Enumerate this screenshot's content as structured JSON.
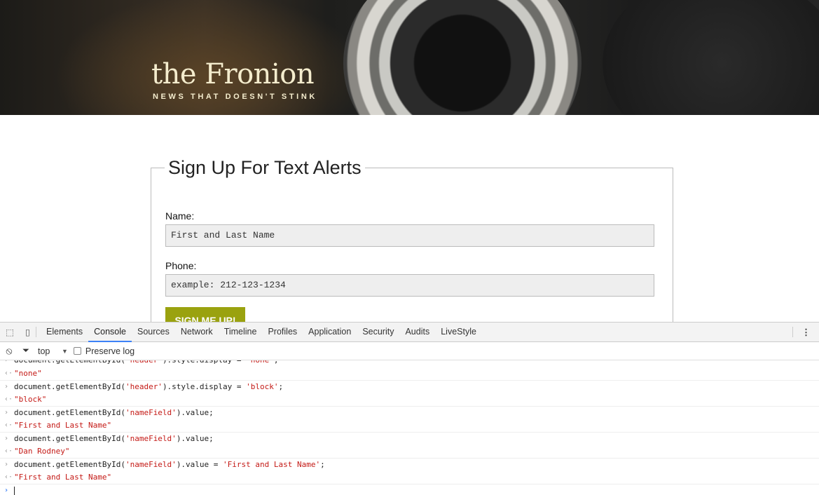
{
  "header": {
    "logo": "the Fronion",
    "tagline": "NEWS THAT DOESN'T STINK"
  },
  "form": {
    "legend": "Sign Up For Text Alerts",
    "name_label": "Name:",
    "name_value": "First and Last Name",
    "phone_label": "Phone:",
    "phone_value": "example: 212-123-1234",
    "submit_label": "SIGN ME UP!",
    "accent": "#9aa20f"
  },
  "devtools": {
    "tabs": [
      "Elements",
      "Console",
      "Sources",
      "Network",
      "Timeline",
      "Profiles",
      "Application",
      "Security",
      "Audits",
      "LiveStyle"
    ],
    "active_tab": "Console",
    "context": "top",
    "preserve_log": "Preserve log",
    "console": [
      {
        "type": "input",
        "pre": "document.getElementById(",
        "str": "'header'",
        "post": ").style.display = ",
        "str2": "'none'",
        "end": ";"
      },
      {
        "type": "output",
        "str": "\"none\""
      },
      {
        "type": "input",
        "pre": "document.getElementById(",
        "str": "'header'",
        "post": ").style.display = ",
        "str2": "'block'",
        "end": ";"
      },
      {
        "type": "output",
        "str": "\"block\""
      },
      {
        "type": "input",
        "pre": "document.getElementById(",
        "str": "'nameField'",
        "post": ").value;",
        "str2": "",
        "end": ""
      },
      {
        "type": "output",
        "str": "\"First and Last Name\""
      },
      {
        "type": "input",
        "pre": "document.getElementById(",
        "str": "'nameField'",
        "post": ").value;",
        "str2": "",
        "end": ""
      },
      {
        "type": "output",
        "str": "\"Dan Rodney\""
      },
      {
        "type": "input",
        "pre": "document.getElementById(",
        "str": "'nameField'",
        "post": ").value = ",
        "str2": "'First and Last Name'",
        "end": ";"
      },
      {
        "type": "output",
        "str": "\"First and Last Name\""
      }
    ]
  }
}
